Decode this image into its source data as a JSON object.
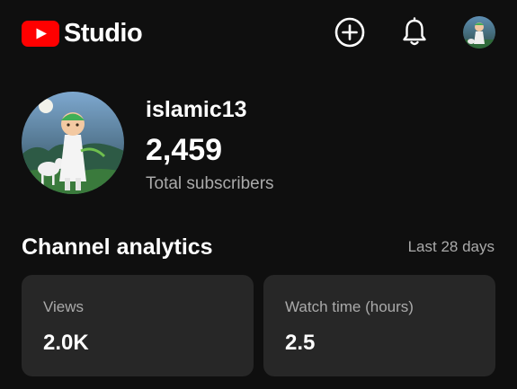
{
  "header": {
    "brand": "Studio",
    "icons": [
      "create-icon",
      "notifications-icon",
      "account-avatar"
    ]
  },
  "channel": {
    "name": "islamic13",
    "subscribers": "2,459",
    "subscribers_label": "Total subscribers"
  },
  "analytics": {
    "title": "Channel analytics",
    "period": "Last 28 days",
    "cards": [
      {
        "label": "Views",
        "value": "2.0K"
      },
      {
        "label": "Watch time (hours)",
        "value": "2.5"
      }
    ]
  },
  "colors": {
    "background": "#0f0f0f",
    "card": "#272727",
    "brand_red": "#ff0000",
    "secondary_text": "#aaaaaa"
  }
}
